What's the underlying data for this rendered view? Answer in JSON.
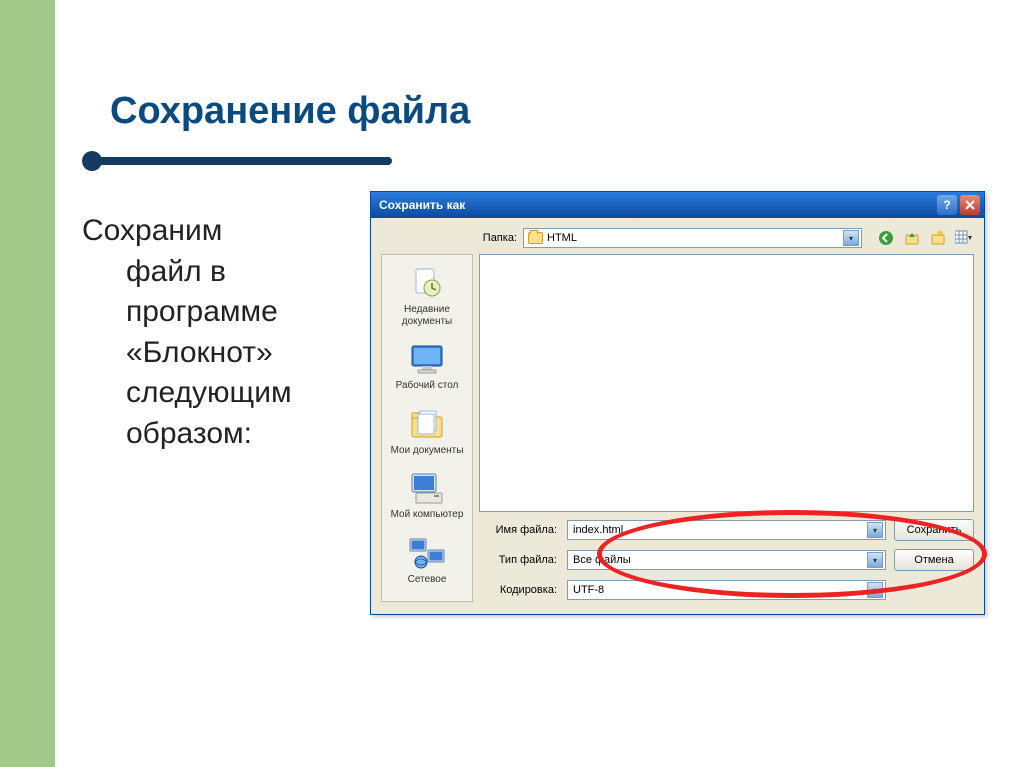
{
  "slide": {
    "title": "Сохранение файла",
    "body_first": "Сохраним",
    "body_rest": "файл в программе «Блокнот» следующим образом:"
  },
  "dialog": {
    "title": "Сохранить как",
    "folder_label": "Папка:",
    "folder_value": "HTML",
    "places": [
      {
        "label": "Недавние документы",
        "icon": "recent"
      },
      {
        "label": "Рабочий стол",
        "icon": "desktop"
      },
      {
        "label": "Мои документы",
        "icon": "mydocs"
      },
      {
        "label": "Мой компьютер",
        "icon": "mycomputer"
      },
      {
        "label": "Сетевое",
        "icon": "network"
      }
    ],
    "fields": {
      "filename_label": "Имя файла:",
      "filename_value": "index.html",
      "filetype_label": "Тип файла:",
      "filetype_value": "Все файлы",
      "encoding_label": "Кодировка:",
      "encoding_value": "UTF-8"
    },
    "buttons": {
      "save": "Сохранить",
      "cancel": "Отмена"
    }
  }
}
